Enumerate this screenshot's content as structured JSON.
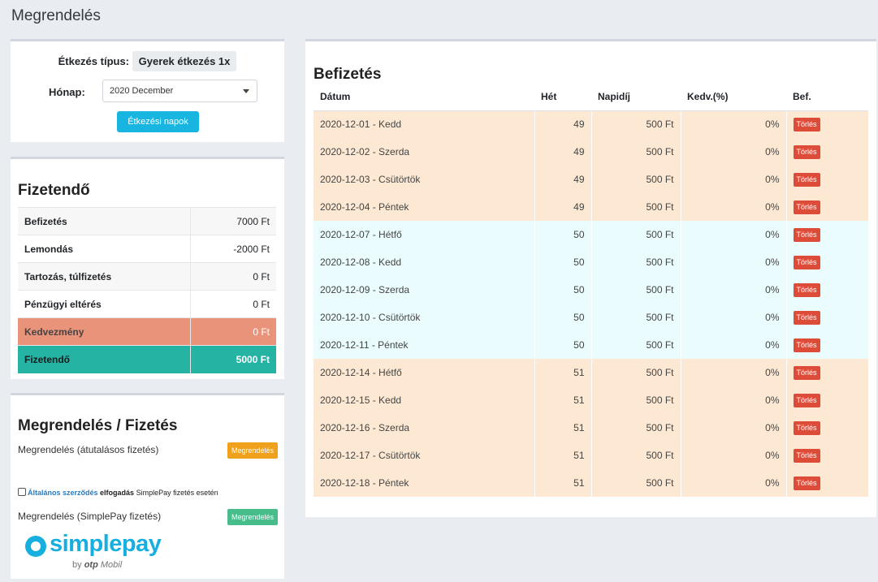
{
  "page_title": "Megrendelés",
  "meal": {
    "type_label": "Étkezés típus:",
    "type_value": "Gyerek étkezés 1x",
    "month_label": "Hónap:",
    "month_value": "2020 December",
    "days_button": "Étkezési napok"
  },
  "due": {
    "title": "Fizetendő",
    "rows": [
      {
        "label": "Befizetés",
        "value": "7000 Ft"
      },
      {
        "label": "Lemondás",
        "value": "-2000 Ft"
      },
      {
        "label": "Tartozás, túlfizetés",
        "value": "0 Ft"
      },
      {
        "label": "Pénzügyi eltérés",
        "value": "0 Ft"
      },
      {
        "label": "Kedvezmény",
        "value": "0 Ft"
      },
      {
        "label": "Fizetendő",
        "value": "5000 Ft"
      }
    ]
  },
  "order": {
    "title": "Megrendelés / Fizetés",
    "transfer_label": "Megrendelés (átutalásos fizetés)",
    "transfer_button": "Megrendelés",
    "terms_link": "Általános szerződés",
    "terms_bold": "elfogadás",
    "terms_rest": "SimplePay fizetés esetén",
    "simplepay_label": "Megrendelés (SimplePay fizetés)",
    "simplepay_button": "Megrendelés",
    "logo_word": "simplepay",
    "logo_by": "by",
    "logo_brand": "otp",
    "logo_mobil": "Mobil"
  },
  "colors": {
    "orange": "#f0a11b",
    "green": "#48bd8c",
    "cyan": "#17b5e0",
    "red": "#dd4b39",
    "teal": "#25b3a4",
    "salmon": "#e9937a"
  },
  "payments": {
    "title": "Befizetés",
    "headers": [
      "Dátum",
      "Hét",
      "Napidíj",
      "Kedv.(%)",
      "Bef."
    ],
    "rows": [
      {
        "date": "2020-12-01 - Kedd",
        "week": "49",
        "fee": "500 Ft",
        "disc": "0%",
        "action": "Törlés"
      },
      {
        "date": "2020-12-02 - Szerda",
        "week": "49",
        "fee": "500 Ft",
        "disc": "0%",
        "action": "Törlés"
      },
      {
        "date": "2020-12-03 - Csütörtök",
        "week": "49",
        "fee": "500 Ft",
        "disc": "0%",
        "action": "Törlés"
      },
      {
        "date": "2020-12-04 - Péntek",
        "week": "49",
        "fee": "500 Ft",
        "disc": "0%",
        "action": "Törlés"
      },
      {
        "date": "2020-12-07 - Hétfő",
        "week": "50",
        "fee": "500 Ft",
        "disc": "0%",
        "action": "Törlés"
      },
      {
        "date": "2020-12-08 - Kedd",
        "week": "50",
        "fee": "500 Ft",
        "disc": "0%",
        "action": "Törlés"
      },
      {
        "date": "2020-12-09 - Szerda",
        "week": "50",
        "fee": "500 Ft",
        "disc": "0%",
        "action": "Törlés"
      },
      {
        "date": "2020-12-10 - Csütörtök",
        "week": "50",
        "fee": "500 Ft",
        "disc": "0%",
        "action": "Törlés"
      },
      {
        "date": "2020-12-11 - Péntek",
        "week": "50",
        "fee": "500 Ft",
        "disc": "0%",
        "action": "Törlés"
      },
      {
        "date": "2020-12-14 - Hétfő",
        "week": "51",
        "fee": "500 Ft",
        "disc": "0%",
        "action": "Törlés"
      },
      {
        "date": "2020-12-15 - Kedd",
        "week": "51",
        "fee": "500 Ft",
        "disc": "0%",
        "action": "Törlés"
      },
      {
        "date": "2020-12-16 - Szerda",
        "week": "51",
        "fee": "500 Ft",
        "disc": "0%",
        "action": "Törlés"
      },
      {
        "date": "2020-12-17 - Csütörtök",
        "week": "51",
        "fee": "500 Ft",
        "disc": "0%",
        "action": "Törlés"
      },
      {
        "date": "2020-12-18 - Péntek",
        "week": "51",
        "fee": "500 Ft",
        "disc": "0%",
        "action": "Törlés"
      }
    ]
  }
}
